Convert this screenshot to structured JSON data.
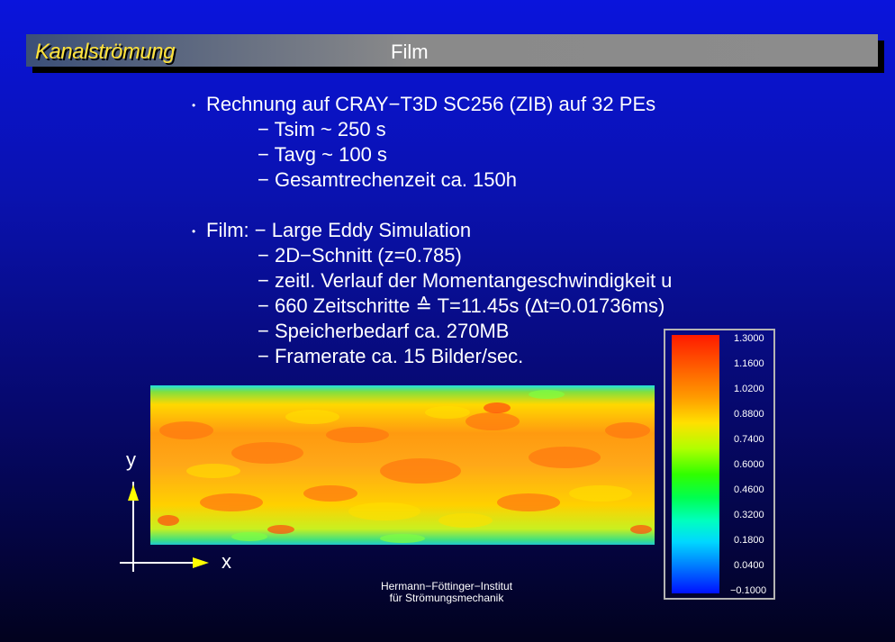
{
  "header": {
    "section": "Kanalströmung",
    "title": "Film"
  },
  "block1": {
    "bullet": "•",
    "head": "Rechnung auf CRAY−T3D SC256 (ZIB) auf 32 PEs",
    "items": [
      "− Tsim ~ 250 s",
      "− Tavg ~ 100 s",
      "−  Gesamtrechenzeit ca. 150h"
    ]
  },
  "block2": {
    "bullet": "•",
    "head": "Film: − Large Eddy Simulation",
    "items": [
      "− 2D−Schnitt (z=0.785)",
      "− zeitl. Verlauf der Momentangeschwindigkeit u",
      "− 660 Zeitschritte ≙ T=11.45s (∆t=0.01736ms)",
      "− Speicherbedarf ca. 270MB",
      "− Framerate ca. 15 Bilder/sec."
    ]
  },
  "axes": {
    "y": "y",
    "x": "x"
  },
  "colorbar": {
    "ticks": [
      "1.3000",
      "1.1600",
      "1.0200",
      "0.8800",
      "0.7400",
      "0.6000",
      "0.4600",
      "0.3200",
      "0.1800",
      "0.0400",
      "−0.1000"
    ],
    "colors": {
      "high": "#ff1a00",
      "mid": "#30ff00",
      "low": "#0010ff"
    }
  },
  "footer": {
    "line1": "Hermann−Föttinger−Institut",
    "line2": "für Strömungsmechanik"
  }
}
